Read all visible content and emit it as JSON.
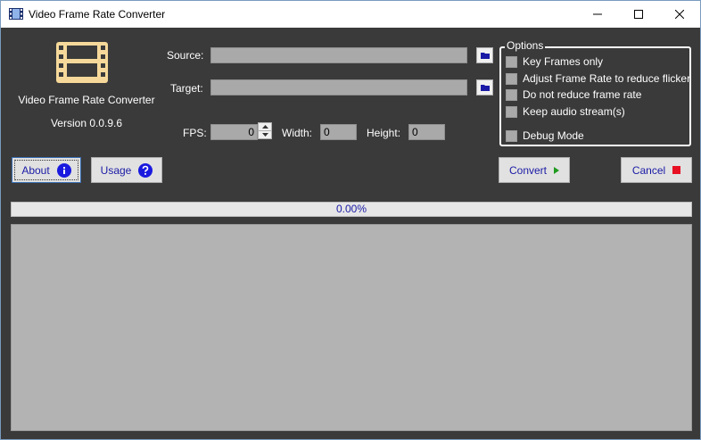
{
  "window": {
    "title": "Video Frame Rate Converter"
  },
  "app": {
    "name": "Video Frame Rate Converter",
    "version": "Version 0.0.9.6"
  },
  "source": {
    "label": "Source:",
    "value": ""
  },
  "target": {
    "label": "Target:",
    "value": ""
  },
  "fps": {
    "label": "FPS:",
    "value": "0"
  },
  "width": {
    "label": "Width:",
    "value": "0"
  },
  "height": {
    "label": "Height:",
    "value": "0"
  },
  "options": {
    "title": "Options",
    "items": [
      {
        "label": "Key Frames only",
        "checked": false
      },
      {
        "label": "Adjust Frame Rate to reduce flicker",
        "checked": false
      },
      {
        "label": "Do not reduce frame rate",
        "checked": false
      },
      {
        "label": "Keep audio stream(s)",
        "checked": false
      },
      {
        "label": "Debug Mode",
        "checked": false
      }
    ]
  },
  "buttons": {
    "about": "About",
    "usage": "Usage",
    "convert": "Convert",
    "cancel": "Cancel"
  },
  "progress": {
    "text": "0.00%",
    "value": 0
  },
  "icons": {
    "about": "info-icon",
    "usage": "question-icon",
    "convert": "play-icon",
    "cancel": "stop-icon",
    "browse": "folder-icon",
    "logo": "film-strip-icon"
  },
  "colors": {
    "accent": "#1a1aa6",
    "background": "#3a3a3a",
    "logo": "#f6d99a",
    "cancel_icon": "#e81123",
    "convert_icon": "#1f9a1f"
  }
}
